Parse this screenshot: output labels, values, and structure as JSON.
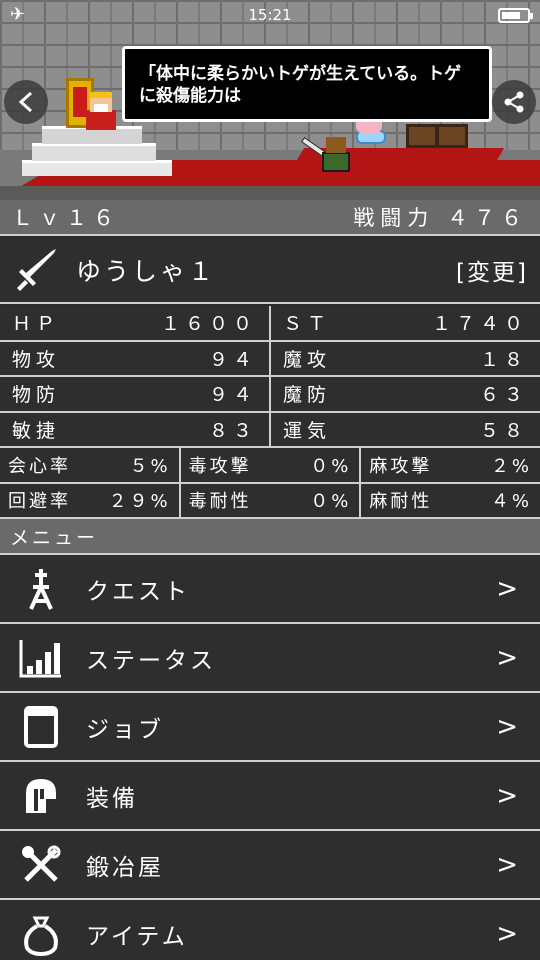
{
  "status_bar": {
    "time": "15:21"
  },
  "scene": {
    "speech": "「体中に柔らかいトゲが生えている。トゲに殺傷能力は",
    "back_glyph": "<",
    "share_glyph": "⟨"
  },
  "level": {
    "level": "Ｌｖ１６",
    "power_label": "戦闘力",
    "power_value": "４７６"
  },
  "character": {
    "name": "ゆうしゃ１",
    "change_label": "[変更]"
  },
  "stats": {
    "hp_label": "ＨＰ",
    "hp": "１６００",
    "st_label": "ＳＴ",
    "st": "１７４０",
    "patk_label": "物攻",
    "patk": "９４",
    "matk_label": "魔攻",
    "matk": "１８",
    "pdef_label": "物防",
    "pdef": "９４",
    "mdef_label": "魔防",
    "mdef": "６３",
    "agi_label": "敏捷",
    "agi": "８３",
    "luck_label": "運気",
    "luck": "５８",
    "crit_label": "会心率",
    "crit": "５%",
    "poison_atk_label": "毒攻撃",
    "poison_atk": "０%",
    "para_atk_label": "麻攻撃",
    "para_atk": "２%",
    "evade_label": "回避率",
    "evade": "２９%",
    "poison_res_label": "毒耐性",
    "poison_res": "０%",
    "para_res_label": "麻耐性",
    "para_res": "４%"
  },
  "menu": {
    "header": "メニュー",
    "items": [
      {
        "label": "クエスト",
        "icon": "tower-icon"
      },
      {
        "label": "ステータス",
        "icon": "bar-chart-icon"
      },
      {
        "label": "ジョブ",
        "icon": "book-icon"
      },
      {
        "label": "装備",
        "icon": "helmet-icon"
      },
      {
        "label": "鍛冶屋",
        "icon": "tools-icon"
      },
      {
        "label": "アイテム",
        "icon": "bag-icon"
      }
    ],
    "arrow": ">"
  }
}
